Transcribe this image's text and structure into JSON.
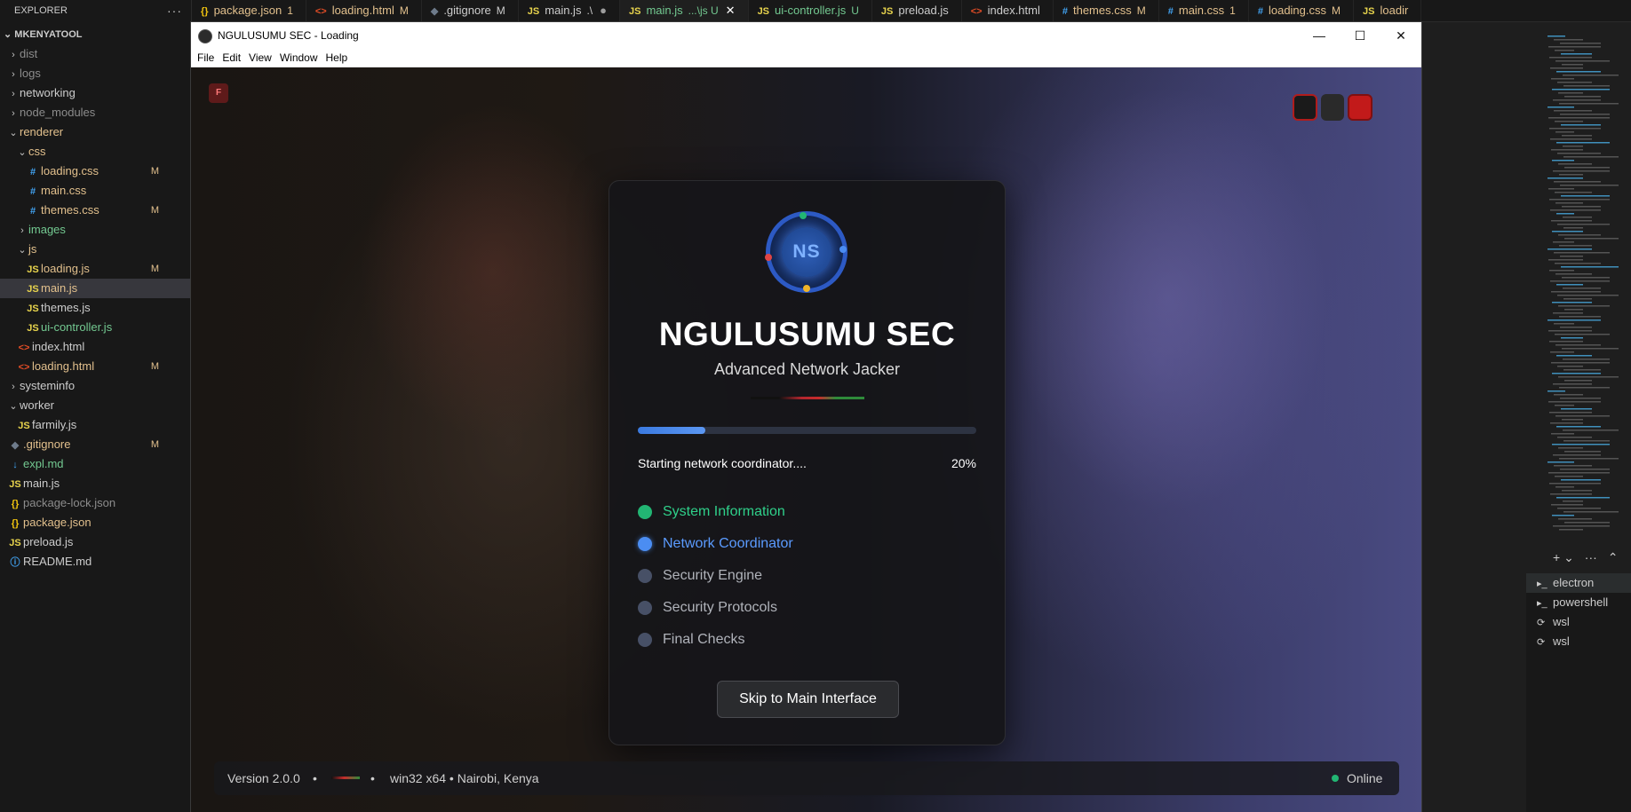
{
  "explorer": {
    "header": "EXPLORER",
    "more": "···",
    "workspace": "MKENYATOOL",
    "items": [
      {
        "label": "dist",
        "chev": "›",
        "icon": "",
        "status": "",
        "cls": "c-dim",
        "indent": 0
      },
      {
        "label": "logs",
        "chev": "›",
        "icon": "",
        "status": "",
        "cls": "c-dim",
        "indent": 0
      },
      {
        "label": "networking",
        "chev": "›",
        "icon": "",
        "status": "",
        "cls": "c-def",
        "indent": 0
      },
      {
        "label": "node_modules",
        "chev": "›",
        "icon": "",
        "status": "",
        "cls": "c-dim",
        "indent": 0
      },
      {
        "label": "renderer",
        "chev": "⌄",
        "icon": "",
        "status": "",
        "cls": "c-mod",
        "indent": 0
      },
      {
        "label": "css",
        "chev": "⌄",
        "icon": "",
        "status": "",
        "cls": "c-mod",
        "indent": 1
      },
      {
        "label": "loading.css",
        "chev": "",
        "icon": "#",
        "status": "M",
        "cls": "c-mod",
        "indent": 2
      },
      {
        "label": "main.css",
        "chev": "",
        "icon": "#",
        "status": "",
        "cls": "c-mod",
        "indent": 2
      },
      {
        "label": "themes.css",
        "chev": "",
        "icon": "#",
        "status": "M",
        "cls": "c-mod",
        "indent": 2
      },
      {
        "label": "images",
        "chev": "›",
        "icon": "",
        "status": "",
        "cls": "c-new",
        "indent": 1
      },
      {
        "label": "js",
        "chev": "⌄",
        "icon": "",
        "status": "",
        "cls": "c-mod",
        "indent": 1
      },
      {
        "label": "loading.js",
        "chev": "",
        "icon": "JS",
        "status": "M",
        "cls": "c-mod",
        "indent": 2
      },
      {
        "label": "main.js",
        "chev": "",
        "icon": "JS",
        "status": "",
        "cls": "c-mod",
        "indent": 2,
        "selected": true
      },
      {
        "label": "themes.js",
        "chev": "",
        "icon": "JS",
        "status": "",
        "cls": "c-def",
        "indent": 2
      },
      {
        "label": "ui-controller.js",
        "chev": "",
        "icon": "JS",
        "status": "",
        "cls": "c-new",
        "indent": 2
      },
      {
        "label": "index.html",
        "chev": "",
        "icon": "<>",
        "status": "",
        "cls": "c-def",
        "indent": 1
      },
      {
        "label": "loading.html",
        "chev": "",
        "icon": "<>",
        "status": "M",
        "cls": "c-mod",
        "indent": 1
      },
      {
        "label": "systeminfo",
        "chev": "›",
        "icon": "",
        "status": "",
        "cls": "c-def",
        "indent": 0
      },
      {
        "label": "worker",
        "chev": "⌄",
        "icon": "",
        "status": "",
        "cls": "c-def",
        "indent": 0
      },
      {
        "label": "farmily.js",
        "chev": "",
        "icon": "JS",
        "status": "",
        "cls": "c-def",
        "indent": 1
      },
      {
        "label": ".gitignore",
        "chev": "",
        "icon": "◆",
        "status": "M",
        "cls": "c-mod",
        "indent": 0
      },
      {
        "label": "expl.md",
        "chev": "",
        "icon": "↓",
        "status": "",
        "cls": "c-new",
        "indent": 0
      },
      {
        "label": "main.js",
        "chev": "",
        "icon": "JS",
        "status": "",
        "cls": "c-def",
        "indent": 0
      },
      {
        "label": "package-lock.json",
        "chev": "",
        "icon": "{}",
        "status": "",
        "cls": "c-dim",
        "indent": 0
      },
      {
        "label": "package.json",
        "chev": "",
        "icon": "{}",
        "status": "",
        "cls": "c-mod",
        "indent": 0
      },
      {
        "label": "preload.js",
        "chev": "",
        "icon": "JS",
        "status": "",
        "cls": "c-def",
        "indent": 0
      },
      {
        "label": "README.md",
        "chev": "",
        "icon": "ⓘ",
        "status": "",
        "cls": "c-def",
        "indent": 0
      }
    ]
  },
  "tabs": [
    {
      "icon": "{}",
      "label": "package.json",
      "status": "1",
      "cls": "c-mod"
    },
    {
      "icon": "<>",
      "label": "loading.html",
      "status": "M",
      "cls": "c-mod"
    },
    {
      "icon": "◆",
      "label": ".gitignore",
      "status": "M",
      "cls": "c-def"
    },
    {
      "icon": "JS",
      "label": "main.js",
      "status": ".\\",
      "cls": "c-def",
      "dot": true
    },
    {
      "icon": "JS",
      "label": "main.js",
      "status": "...\\js U",
      "cls": "c-new",
      "active": true
    },
    {
      "icon": "JS",
      "label": "ui-controller.js",
      "status": "U",
      "cls": "c-new"
    },
    {
      "icon": "JS",
      "label": "preload.js",
      "status": "",
      "cls": "c-def"
    },
    {
      "icon": "<>",
      "label": "index.html",
      "status": "",
      "cls": "c-def"
    },
    {
      "icon": "#",
      "label": "themes.css",
      "status": "M",
      "cls": "c-mod"
    },
    {
      "icon": "#",
      "label": "main.css",
      "status": "1",
      "cls": "c-mod"
    },
    {
      "icon": "#",
      "label": "loading.css",
      "status": "M",
      "cls": "c-mod"
    },
    {
      "icon": "JS",
      "label": "loadir",
      "status": "",
      "cls": "c-mod"
    }
  ],
  "terminal": {
    "toolbar": [
      "+ ⌄",
      "···",
      "⌃"
    ],
    "items": [
      {
        "label": "electron",
        "icon": "▸_",
        "selected": true
      },
      {
        "label": "powershell",
        "icon": "▸_"
      },
      {
        "label": "wsl",
        "icon": "⟳"
      },
      {
        "label": "wsl",
        "icon": "⟳"
      }
    ]
  },
  "window": {
    "title": "NGULUSUMU SEC - Loading",
    "minimize": "—",
    "maximize": "☐",
    "close": "✕",
    "menu": [
      "File",
      "Edit",
      "View",
      "Window",
      "Help"
    ]
  },
  "app": {
    "corner_badge": "F",
    "logo_text": "NS",
    "title": "NGULUSUMU SEC",
    "subtitle": "Advanced Network Jacker",
    "progress_fraction": 0.2,
    "status": "Starting network coordinator....",
    "percent": "20%",
    "steps": [
      {
        "label": "System Information",
        "state": "done"
      },
      {
        "label": "Network Coordinator",
        "state": "active"
      },
      {
        "label": "Security Engine",
        "state": "pending"
      },
      {
        "label": "Security Protocols",
        "state": "pending"
      },
      {
        "label": "Final Checks",
        "state": "pending"
      }
    ],
    "skip_button": "Skip to Main Interface",
    "footer": {
      "version": "Version 2.0.0",
      "sep": "•",
      "platform": "win32 x64 • Nairobi, Kenya",
      "online": "Online"
    },
    "colors": {
      "accent": "#4b8df2",
      "done": "#22b573",
      "kenya_red": "#c72c2c",
      "kenya_green": "#2e8b3a"
    }
  }
}
